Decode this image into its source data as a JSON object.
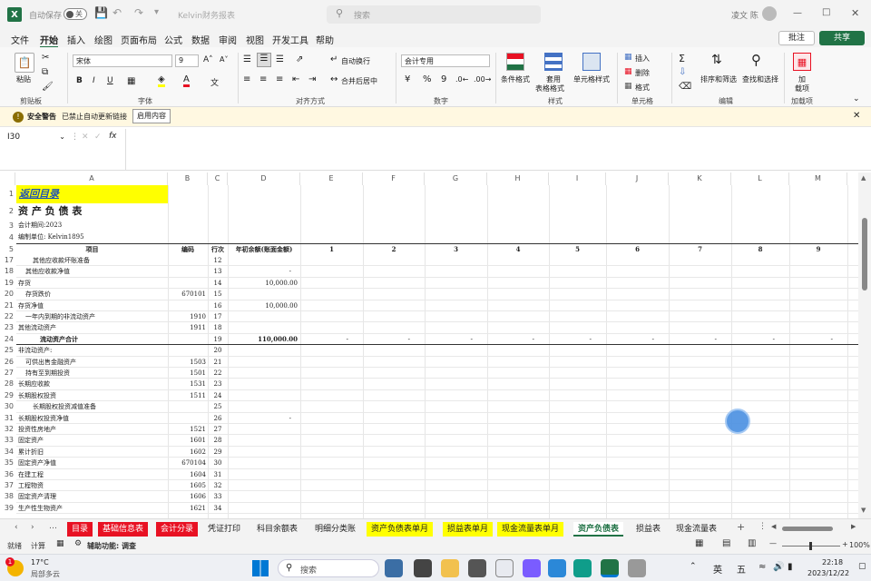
{
  "titlebar": {
    "autosave_label": "自动保存",
    "autosave_state": "关",
    "doc_title": "Kelvin财务报表",
    "search_placeholder": "搜索",
    "user_name": "凌文 陈"
  },
  "menu": [
    "文件",
    "开始",
    "插入",
    "绘图",
    "页面布局",
    "公式",
    "数据",
    "审阅",
    "视图",
    "开发工具",
    "帮助"
  ],
  "menu_active": "开始",
  "comment_btn": "批注",
  "share_btn": "共享",
  "ribbon": {
    "paste": "粘贴",
    "clipboard": "剪贴板",
    "font_name": "宋体",
    "font_size": "9",
    "font_group": "字体",
    "wrap": "自动换行",
    "merge": "合并后居中",
    "align_group": "对齐方式",
    "num_format": "会计专用",
    "num_group": "数字",
    "cond_format": "条件格式",
    "table_format_1": "套用",
    "table_format_2": "表格格式",
    "cell_style": "单元格样式",
    "style_group": "样式",
    "insert": "插入",
    "delete": "删除",
    "format": "格式",
    "cells_group": "单元格",
    "sort": "排序和筛选",
    "find": "查找和选择",
    "edit_group": "编辑",
    "addin_1": "加",
    "addin_2": "载项",
    "addin_group": "加载项"
  },
  "security": {
    "title": "安全警告",
    "message": "已禁止自动更新链接",
    "button": "启用内容"
  },
  "formula": {
    "namebox": "I30",
    "fx": "fx",
    "value": ""
  },
  "columns": [
    "A",
    "B",
    "C",
    "D",
    "E",
    "F",
    "G",
    "H",
    "I",
    "J",
    "K",
    "L",
    "M"
  ],
  "sheet_header": {
    "back_link": "返回目录",
    "title": "资 产 负 债 表",
    "period": "会计期间:2023",
    "unit": "编制单位: Kelvin1895",
    "h_item": "项目",
    "h_code": "编码",
    "h_line": "行次",
    "h_balance": "年初余额(账面金额)",
    "h_nums": [
      "1",
      "2",
      "3",
      "4",
      "5",
      "6",
      "7",
      "8",
      "9"
    ]
  },
  "rows": [
    {
      "n": "17",
      "item": "其他应收款坏账准备",
      "indent": 2,
      "code": "",
      "line": "12",
      "bal": ""
    },
    {
      "n": "18",
      "item": "其他应收款净值",
      "indent": 1,
      "code": "",
      "line": "13",
      "bal": "-"
    },
    {
      "n": "19",
      "item": "存货",
      "indent": 0,
      "code": "",
      "line": "14",
      "bal": "10,000.00"
    },
    {
      "n": "20",
      "item": "存货跌价",
      "indent": 1,
      "code": "670101",
      "line": "15",
      "bal": ""
    },
    {
      "n": "21",
      "item": "存货净值",
      "indent": 0,
      "code": "",
      "line": "16",
      "bal": "10,000.00"
    },
    {
      "n": "22",
      "item": "一年内到期的非流动资产",
      "indent": 1,
      "code": "1910",
      "line": "17",
      "bal": ""
    },
    {
      "n": "23",
      "item": "其他流动资产",
      "indent": 0,
      "code": "1911",
      "line": "18",
      "bal": ""
    },
    {
      "n": "24",
      "item": "流动资产合计",
      "indent": 3,
      "code": "",
      "line": "19",
      "bal": "110,000.00",
      "bold": true,
      "dashes": true
    },
    {
      "n": "25",
      "item": "非流动资产:",
      "indent": 0,
      "code": "",
      "line": "20",
      "bal": ""
    },
    {
      "n": "26",
      "item": "可供出售金融资产",
      "indent": 1,
      "code": "1503",
      "line": "21",
      "bal": ""
    },
    {
      "n": "27",
      "item": "持有至到期投资",
      "indent": 1,
      "code": "1501",
      "line": "22",
      "bal": ""
    },
    {
      "n": "28",
      "item": "长期应收款",
      "indent": 0,
      "code": "1531",
      "line": "23",
      "bal": ""
    },
    {
      "n": "29",
      "item": "长期股权投资",
      "indent": 0,
      "code": "1511",
      "line": "24",
      "bal": ""
    },
    {
      "n": "30",
      "item": "长期股权投资减值准备",
      "indent": 2,
      "code": "",
      "line": "25",
      "bal": ""
    },
    {
      "n": "31",
      "item": "长期股权投资净值",
      "indent": 0,
      "code": "",
      "line": "26",
      "bal": "-"
    },
    {
      "n": "32",
      "item": "投资性房地产",
      "indent": 0,
      "code": "1521",
      "line": "27",
      "bal": ""
    },
    {
      "n": "33",
      "item": "固定资产",
      "indent": 0,
      "code": "1601",
      "line": "28",
      "bal": ""
    },
    {
      "n": "34",
      "item": "累计折旧",
      "indent": 0,
      "code": "1602",
      "line": "29",
      "bal": ""
    },
    {
      "n": "35",
      "item": "固定资产净值",
      "indent": 0,
      "code": "670104",
      "line": "30",
      "bal": ""
    },
    {
      "n": "36",
      "item": "在建工程",
      "indent": 0,
      "code": "1604",
      "line": "31",
      "bal": ""
    },
    {
      "n": "37",
      "item": "工程物资",
      "indent": 0,
      "code": "1605",
      "line": "32",
      "bal": ""
    },
    {
      "n": "38",
      "item": "固定资产清理",
      "indent": 0,
      "code": "1606",
      "line": "33",
      "bal": ""
    },
    {
      "n": "39",
      "item": "生产性生物资产",
      "indent": 0,
      "code": "1621",
      "line": "34",
      "bal": ""
    }
  ],
  "dash": "-",
  "tabs": [
    {
      "label": "目录",
      "style": "red"
    },
    {
      "label": "基础信息表",
      "style": "red"
    },
    {
      "label": "会计分录",
      "style": "red"
    },
    {
      "label": "凭证打印",
      "style": "plain"
    },
    {
      "label": "科目余额表",
      "style": "plain"
    },
    {
      "label": "明细分类账",
      "style": "plain"
    },
    {
      "label": "资产负债表单月",
      "style": "yellow"
    },
    {
      "label": "损益表单月",
      "style": "yellow"
    },
    {
      "label": "现金流量表单月",
      "style": "yellow"
    },
    {
      "label": "资产负债表",
      "style": "active"
    },
    {
      "label": "损益表",
      "style": "plain"
    },
    {
      "label": "现金流量表",
      "style": "plain"
    }
  ],
  "status": {
    "ready": "就绪",
    "calc": "计算",
    "accessibility": "辅助功能: 调查",
    "zoom": "100%"
  },
  "taskbar": {
    "temp": "17°C",
    "weather": "局部多云",
    "search": "搜索",
    "time": "22:18",
    "date": "2023/12/22",
    "ime1": "英",
    "ime2": "五",
    "badge": "1"
  },
  "colors": {
    "green": "#217346",
    "red_tab": "#e81123",
    "yellow_tab": "#ffff00",
    "back_link_bg": "#ffff00"
  }
}
